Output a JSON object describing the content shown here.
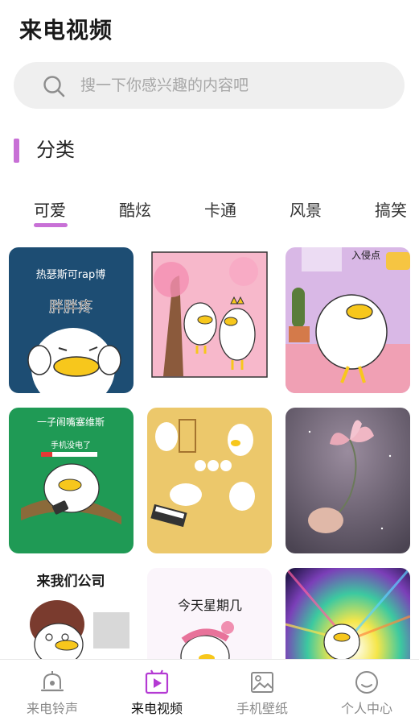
{
  "header": {
    "title": "来电视频"
  },
  "search": {
    "placeholder": "搜一下你感兴趣的内容吧",
    "icon": "search-icon"
  },
  "section": {
    "title": "分类",
    "accent_color": "#c870d6"
  },
  "tabs": [
    {
      "label": "可爱",
      "active": true
    },
    {
      "label": "酷炫",
      "active": false
    },
    {
      "label": "卡通",
      "active": false
    },
    {
      "label": "风景",
      "active": false
    },
    {
      "label": "搞笑",
      "active": false
    }
  ],
  "grid": {
    "items": [
      {
        "caption": "热瑟斯可rap博",
        "sub": "胖胖疼"
      },
      {
        "caption": ""
      },
      {
        "caption": "入侵点"
      },
      {
        "caption": "一子闹嘴塞维斯",
        "sub": "手机没电了"
      },
      {
        "caption": ""
      },
      {
        "caption": ""
      },
      {
        "caption": "来我们公司"
      },
      {
        "caption": "今天星期几"
      },
      {
        "caption": ""
      }
    ]
  },
  "bottom_nav": [
    {
      "label": "来电铃声",
      "icon": "bell-icon",
      "active": false
    },
    {
      "label": "来电视频",
      "icon": "video-play-icon",
      "active": true
    },
    {
      "label": "手机壁纸",
      "icon": "image-icon",
      "active": false
    },
    {
      "label": "个人中心",
      "icon": "smile-icon",
      "active": false
    }
  ]
}
